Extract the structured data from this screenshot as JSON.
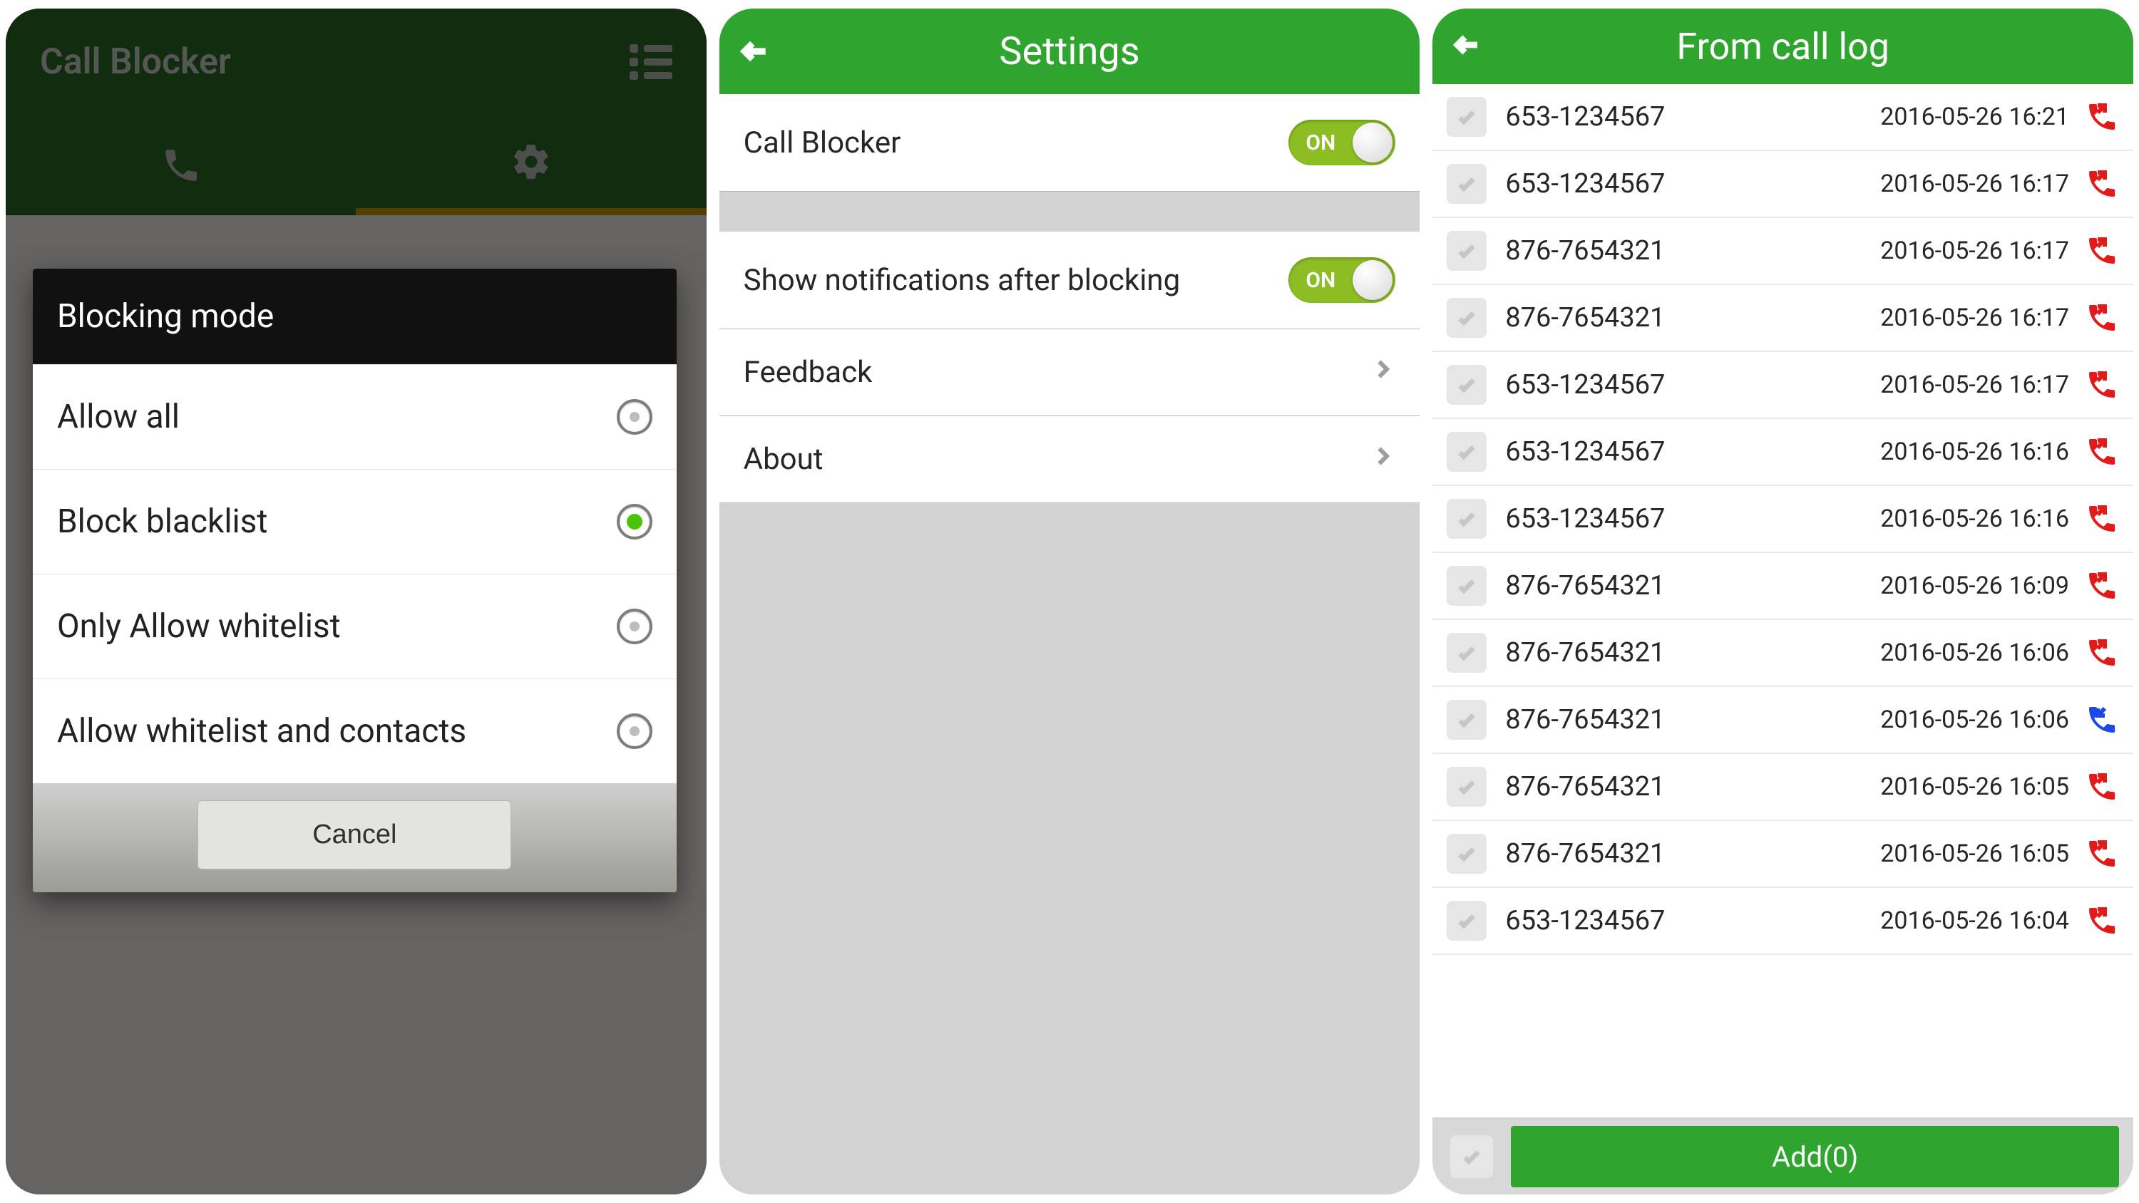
{
  "screen1": {
    "appbar_title": "Call Blocker",
    "dialog_title": "Blocking mode",
    "options": [
      {
        "label": "Allow all",
        "selected": false
      },
      {
        "label": "Block blacklist",
        "selected": true
      },
      {
        "label": "Only Allow whitelist",
        "selected": false
      },
      {
        "label": "Allow whitelist and contacts",
        "selected": false
      }
    ],
    "cancel_label": "Cancel"
  },
  "screen2": {
    "appbar_title": "Settings",
    "rows": {
      "call_blocker": {
        "label": "Call Blocker",
        "toggle_text": "ON",
        "on": true
      },
      "notifications": {
        "label": "Show notifications after blocking",
        "toggle_text": "ON",
        "on": true
      },
      "feedback": {
        "label": "Feedback"
      },
      "about": {
        "label": "About"
      }
    }
  },
  "screen3": {
    "appbar_title": "From call log",
    "entries": [
      {
        "number": "653-1234567",
        "time": "2016-05-26 16:21",
        "type": "out"
      },
      {
        "number": "653-1234567",
        "time": "2016-05-26 16:17",
        "type": "out"
      },
      {
        "number": "876-7654321",
        "time": "2016-05-26 16:17",
        "type": "out"
      },
      {
        "number": "876-7654321",
        "time": "2016-05-26 16:17",
        "type": "out"
      },
      {
        "number": "653-1234567",
        "time": "2016-05-26 16:17",
        "type": "out"
      },
      {
        "number": "653-1234567",
        "time": "2016-05-26 16:16",
        "type": "out"
      },
      {
        "number": "653-1234567",
        "time": "2016-05-26 16:16",
        "type": "out"
      },
      {
        "number": "876-7654321",
        "time": "2016-05-26 16:09",
        "type": "out"
      },
      {
        "number": "876-7654321",
        "time": "2016-05-26 16:06",
        "type": "out"
      },
      {
        "number": "876-7654321",
        "time": "2016-05-26 16:06",
        "type": "in"
      },
      {
        "number": "876-7654321",
        "time": "2016-05-26 16:05",
        "type": "out"
      },
      {
        "number": "876-7654321",
        "time": "2016-05-26 16:05",
        "type": "out"
      },
      {
        "number": "653-1234567",
        "time": "2016-05-26 16:04",
        "type": "out"
      }
    ],
    "add_button_label": "Add(0)"
  },
  "colors": {
    "green": "#2fa52f",
    "toggle_green": "#8cbe24",
    "red": "#e11b1b",
    "blue": "#1f49e6"
  }
}
